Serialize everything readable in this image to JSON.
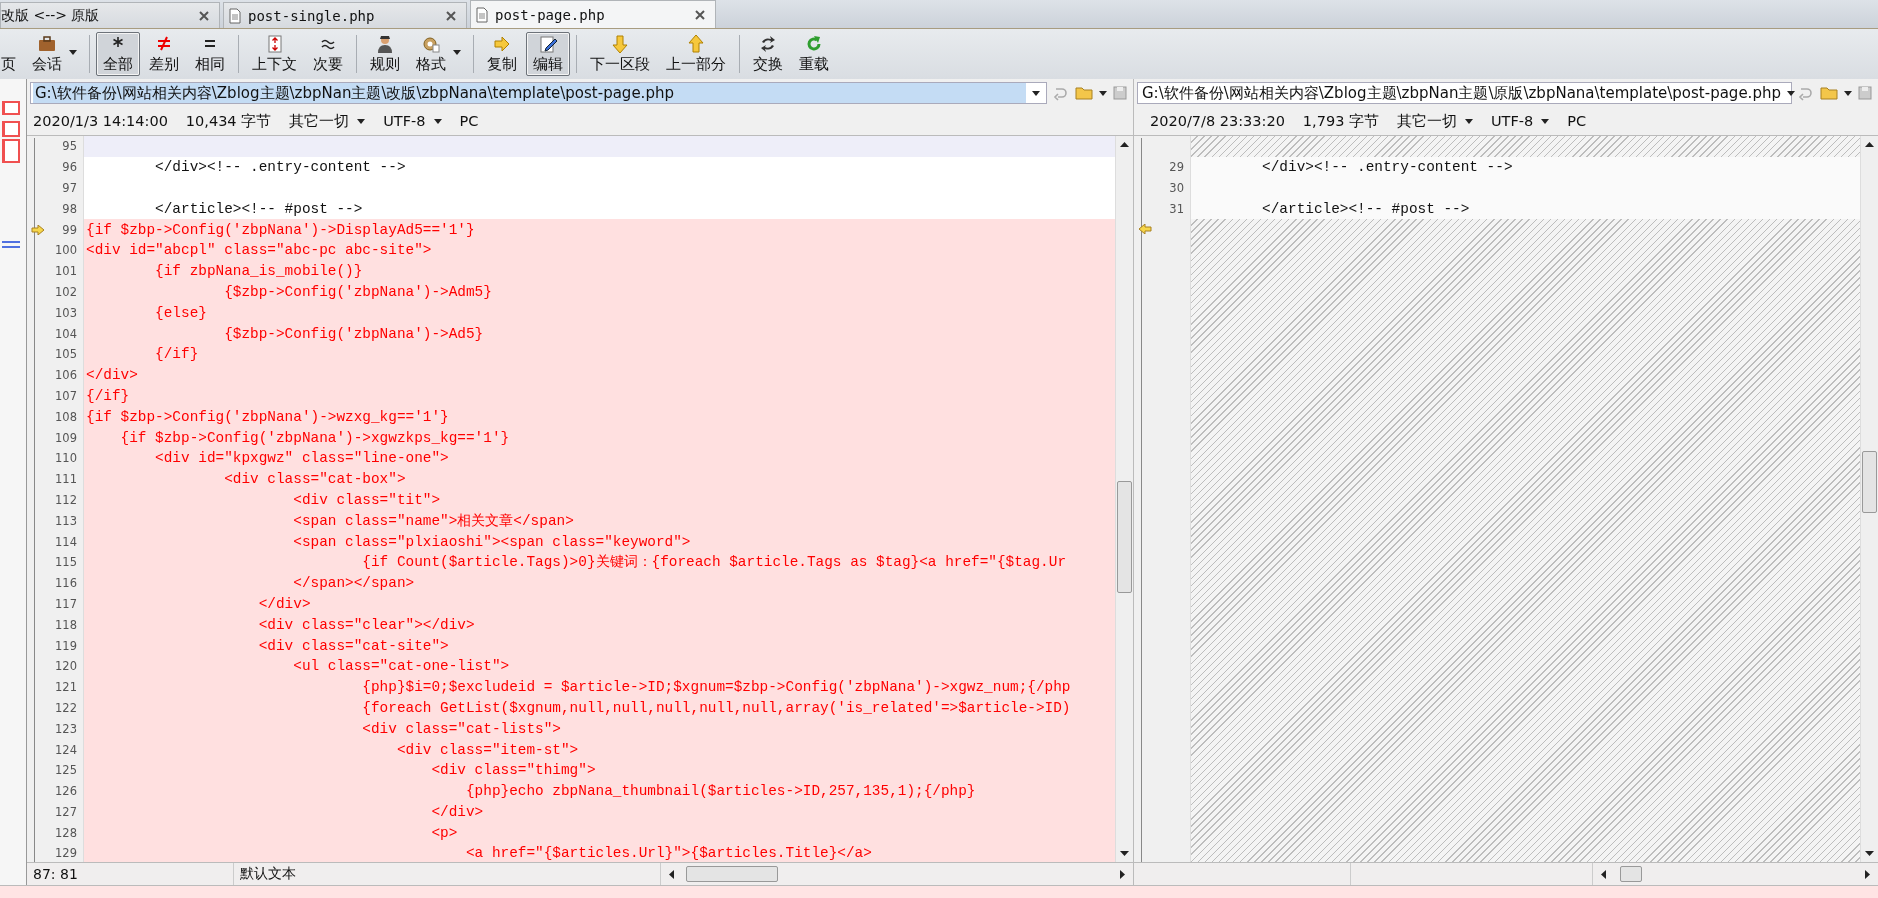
{
  "tabs": [
    {
      "label": "改版 <--> 原版",
      "kind": "session",
      "selected": false
    },
    {
      "label": "post-single.php",
      "kind": "file",
      "selected": false
    },
    {
      "label": "post-page.php",
      "kind": "file",
      "selected": true
    }
  ],
  "toolbar": {
    "groups": [
      [
        {
          "label": "页",
          "selected": false,
          "dropdown": false
        },
        {
          "label": "会话",
          "selected": false,
          "dropdown": true
        }
      ],
      [
        {
          "label": "全部",
          "selected": true,
          "dropdown": false
        },
        {
          "label": "差别",
          "selected": false,
          "dropdown": false
        },
        {
          "label": "相同",
          "selected": false,
          "dropdown": false
        }
      ],
      [
        {
          "label": "上下文",
          "selected": false,
          "dropdown": false
        },
        {
          "label": "次要",
          "selected": false,
          "dropdown": false
        }
      ],
      [
        {
          "label": "规则",
          "selected": false,
          "dropdown": false
        },
        {
          "label": "格式",
          "selected": false,
          "dropdown": true
        }
      ],
      [
        {
          "label": "复制",
          "selected": false,
          "dropdown": false
        },
        {
          "label": "编辑",
          "selected": true,
          "dropdown": false
        }
      ],
      [
        {
          "label": "下一区段",
          "selected": false,
          "dropdown": false
        },
        {
          "label": "上一部分",
          "selected": false,
          "dropdown": false
        }
      ],
      [
        {
          "label": "交换",
          "selected": false,
          "dropdown": false
        },
        {
          "label": "重载",
          "selected": false,
          "dropdown": false
        }
      ]
    ]
  },
  "panes": [
    {
      "path": "G:\\软件备份\\网站相关内容\\Zblog主题\\zbpNan主题\\改版\\zbpNana\\template\\post-page.php",
      "path_selected": true,
      "info": {
        "timestamp": "2020/1/3 14:14:00",
        "size": "10,434 字节",
        "filter": "其它一切",
        "encoding": "UTF-8",
        "line_end": "PC"
      },
      "lines": [
        {
          "kind": "current",
          "number": "95",
          "arrow": false
        },
        {
          "kind": "same",
          "number": "96",
          "text": "        </div><!-- .entry-content -->",
          "arrow": false
        },
        {
          "kind": "same",
          "number": "97",
          "arrow": false
        },
        {
          "kind": "same",
          "number": "98",
          "text": "        </article><!-- #post -->",
          "arrow": false
        },
        {
          "kind": "changed",
          "number": "99",
          "text": "{if $zbp->Config('zbpNana')->DisplayAd5=='1'}",
          "arrow": true
        },
        {
          "kind": "changed",
          "number": "100",
          "text": "<div id=\"abcpl\" class=\"abc-pc abc-site\">",
          "arrow": false
        },
        {
          "kind": "changed",
          "number": "101",
          "text": "        {if zbpNana_is_mobile()}",
          "arrow": false
        },
        {
          "kind": "changed",
          "number": "102",
          "text": "                {$zbp->Config('zbpNana')->Adm5}",
          "arrow": false
        },
        {
          "kind": "changed",
          "number": "103",
          "text": "        {else}",
          "arrow": false
        },
        {
          "kind": "changed",
          "number": "104",
          "text": "                {$zbp->Config('zbpNana')->Ad5}",
          "arrow": false
        },
        {
          "kind": "changed",
          "number": "105",
          "text": "        {/if}",
          "arrow": false
        },
        {
          "kind": "changed",
          "number": "106",
          "text": "</div>",
          "arrow": false
        },
        {
          "kind": "changed",
          "number": "107",
          "text": "{/if}",
          "arrow": false
        },
        {
          "kind": "changed",
          "number": "108",
          "text": "{if $zbp->Config('zbpNana')->wzxg_kg=='1'}",
          "arrow": false
        },
        {
          "kind": "changed",
          "number": "109",
          "text": "    {if $zbp->Config('zbpNana')->xgwzkps_kg=='1'}",
          "arrow": false
        },
        {
          "kind": "changed",
          "number": "110",
          "text": "        <div id=\"kpxgwz\" class=\"line-one\">",
          "arrow": false
        },
        {
          "kind": "changed",
          "number": "111",
          "text": "                <div class=\"cat-box\">",
          "arrow": false
        },
        {
          "kind": "changed",
          "number": "112",
          "text": "                        <div class=\"tit\">",
          "arrow": false
        },
        {
          "kind": "changed",
          "number": "113",
          "text": "                        <span class=\"name\">相关文章</span>",
          "arrow": false
        },
        {
          "kind": "changed",
          "number": "114",
          "text": "                        <span class=\"plxiaoshi\"><span class=\"keyword\">",
          "arrow": false
        },
        {
          "kind": "changed",
          "number": "115",
          "text": "                                {if Count($article.Tags)>0}关键词：{foreach $article.Tags as $tag}<a href=\"{$tag.Ur",
          "arrow": false
        },
        {
          "kind": "changed",
          "number": "116",
          "text": "                        </span></span>",
          "arrow": false
        },
        {
          "kind": "changed",
          "number": "117",
          "text": "                    </div>",
          "arrow": false
        },
        {
          "kind": "changed",
          "number": "118",
          "text": "                    <div class=\"clear\"></div>",
          "arrow": false
        },
        {
          "kind": "changed",
          "number": "119",
          "text": "                    <div class=\"cat-site\">",
          "arrow": false
        },
        {
          "kind": "changed",
          "number": "120",
          "text": "                        <ul class=\"cat-one-list\">",
          "arrow": false
        },
        {
          "kind": "changed",
          "number": "121",
          "text": "                                {php}$i=0;$excludeid = $article->ID;$xgnum=$zbp->Config('zbpNana')->xgwz_num;{/php",
          "arrow": false
        },
        {
          "kind": "changed",
          "number": "122",
          "text": "                                {foreach GetList($xgnum,null,null,null,null,null,array('is_related'=>$article->ID)",
          "arrow": false
        },
        {
          "kind": "changed",
          "number": "123",
          "text": "                                <div class=\"cat-lists\">",
          "arrow": false
        },
        {
          "kind": "changed",
          "number": "124",
          "text": "                                    <div class=\"item-st\">",
          "arrow": false
        },
        {
          "kind": "changed",
          "number": "125",
          "text": "                                        <div class=\"thimg\">",
          "arrow": false
        },
        {
          "kind": "changed",
          "number": "126",
          "text": "                                            {php}echo zbpNana_thumbnail($articles->ID,257,135,1);{/php}",
          "arrow": false
        },
        {
          "kind": "changed",
          "number": "127",
          "text": "                                        </div>",
          "arrow": false
        },
        {
          "kind": "changed",
          "number": "128",
          "text": "                                        <p>",
          "arrow": false
        },
        {
          "kind": "changed",
          "number": "129",
          "text": "                                            <a href=\"{$articles.Url}\">{$articles.Title}</a>",
          "arrow": false
        }
      ],
      "status": {
        "position": "87: 81",
        "mode": "默认文本"
      }
    },
    {
      "path": "G:\\软件备份\\网站相关内容\\Zblog主题\\zbpNan主题\\原版\\zbpNana\\template\\post-page.php",
      "path_selected": false,
      "info": {
        "timestamp": "2020/7/8 23:33:20",
        "size": "1,793 字节",
        "filter": "其它一切",
        "encoding": "UTF-8",
        "line_end": "PC"
      },
      "lines": [
        {
          "kind": "missing",
          "arrow": false
        },
        {
          "kind": "same",
          "number": "29",
          "text": "        </div><!-- .entry-content -->",
          "arrow": false
        },
        {
          "kind": "same",
          "number": "30",
          "arrow": false
        },
        {
          "kind": "same",
          "number": "31",
          "text": "        </article><!-- #post -->",
          "arrow": false
        },
        {
          "kind": "missing",
          "arrow": true
        }
      ]
    }
  ]
}
